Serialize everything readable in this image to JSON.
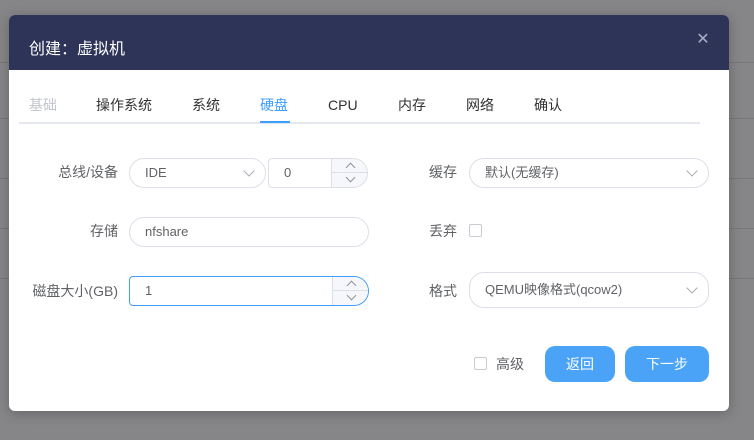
{
  "dialog": {
    "title": "创建：虚拟机",
    "close_icon": "close-icon"
  },
  "tabs": [
    {
      "label": "基础",
      "state": "disabled"
    },
    {
      "label": "操作系统",
      "state": "normal"
    },
    {
      "label": "系统",
      "state": "normal"
    },
    {
      "label": "硬盘",
      "state": "active"
    },
    {
      "label": "CPU",
      "state": "normal"
    },
    {
      "label": "内存",
      "state": "normal"
    },
    {
      "label": "网络",
      "state": "normal"
    },
    {
      "label": "确认",
      "state": "normal"
    }
  ],
  "form": {
    "bus_label": "总线/设备",
    "bus_value": "IDE",
    "device_value": "0",
    "cache_label": "缓存",
    "cache_value": "默认(无缓存)",
    "storage_label": "存储",
    "storage_value": "nfshare",
    "discard_label": "丢弃",
    "discard_checked": false,
    "size_label": "磁盘大小(GB)",
    "size_value": "1",
    "format_label": "格式",
    "format_value": "QEMU映像格式(qcow2)"
  },
  "footer": {
    "advanced_label": "高级",
    "advanced_checked": false,
    "back_label": "返回",
    "next_label": "下一步"
  },
  "colors": {
    "header_bg": "#2d3457",
    "accent": "#409eff",
    "button_bg": "#4aa3f7"
  }
}
